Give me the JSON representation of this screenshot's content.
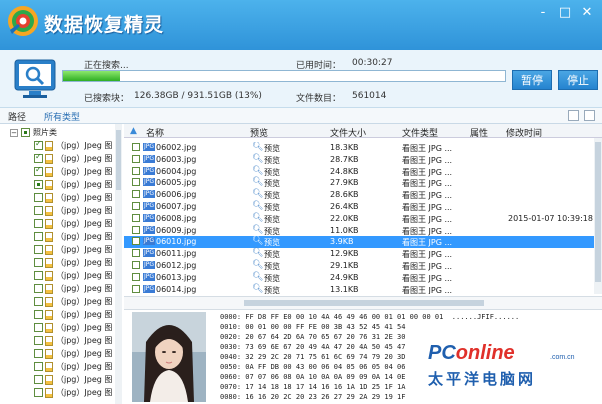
{
  "app": {
    "title": "数据恢复精灵"
  },
  "window": {
    "minimize": "-",
    "restore": "□",
    "close": "✕"
  },
  "scan": {
    "status_label": "正在搜索...",
    "elapsed_label": "已用时间：",
    "elapsed_value": "00:30:27",
    "searched_label": "已搜索块：",
    "searched_value": "126.38GB / 931.51GB (13%)",
    "progress_percent": 13,
    "count_label": "文件数目：",
    "count_value": "561014",
    "pause_button": "暂停",
    "stop_button": "停止"
  },
  "tabs": {
    "path": "路径",
    "all_types": "所有类型"
  },
  "tree": {
    "root": "照片类",
    "items": [
      "（jpg）Jpeg 图",
      "（jpg）Jpeg 图",
      "（jpg）Jpeg 图",
      "（jpg）Jpeg 图",
      "（jpg）Jpeg 图",
      "（jpg）Jpeg 图",
      "（jpg）Jpeg 图",
      "（jpg）Jpeg 图",
      "（jpg）Jpeg 图",
      "（jpg）Jpeg 图",
      "（jpg）Jpeg 图",
      "（jpg）Jpeg 图",
      "（jpg）Jpeg 图",
      "（jpg）Jpeg 图",
      "（jpg）Jpeg 图",
      "（jpg）Jpeg 图",
      "（jpg）Jpeg 图",
      "（jpg）Jpeg 图",
      "（jpg）Jpeg 图",
      "（jpg）Jpeg 图"
    ]
  },
  "table": {
    "headers": {
      "name": "名称",
      "preview": "预览",
      "size": "文件大小",
      "type": "文件类型",
      "attr": "属性",
      "modified": "修改时间"
    },
    "rows": [
      {
        "name": "06002.jpg",
        "preview": "预览",
        "size": "18.3KB",
        "type": "看图王 JPG ...",
        "modified": ""
      },
      {
        "name": "06003.jpg",
        "preview": "预览",
        "size": "28.7KB",
        "type": "看图王 JPG ...",
        "modified": ""
      },
      {
        "name": "06004.jpg",
        "preview": "预览",
        "size": "24.8KB",
        "type": "看图王 JPG ...",
        "modified": ""
      },
      {
        "name": "06005.jpg",
        "preview": "预览",
        "size": "27.9KB",
        "type": "看图王 JPG ...",
        "modified": ""
      },
      {
        "name": "06006.jpg",
        "preview": "预览",
        "size": "28.6KB",
        "type": "看图王 JPG ...",
        "modified": ""
      },
      {
        "name": "06007.jpg",
        "preview": "预览",
        "size": "26.4KB",
        "type": "看图王 JPG ...",
        "modified": ""
      },
      {
        "name": "06008.jpg",
        "preview": "预览",
        "size": "22.0KB",
        "type": "看图王 JPG ...",
        "modified": "2015-01-07 10:39:18"
      },
      {
        "name": "06009.jpg",
        "preview": "预览",
        "size": "11.0KB",
        "type": "看图王 JPG ...",
        "modified": ""
      },
      {
        "name": "06010.jpg",
        "preview": "预览",
        "size": "3.9KB",
        "type": "看图王 JPG ...",
        "modified": ""
      },
      {
        "name": "06011.jpg",
        "preview": "预览",
        "size": "12.9KB",
        "type": "看图王 JPG ...",
        "modified": ""
      },
      {
        "name": "06012.jpg",
        "preview": "预览",
        "size": "29.1KB",
        "type": "看图王 JPG ...",
        "modified": ""
      },
      {
        "name": "06013.jpg",
        "preview": "预览",
        "size": "24.9KB",
        "type": "看图王 JPG ...",
        "modified": ""
      },
      {
        "name": "06014.jpg",
        "preview": "预览",
        "size": "13.1KB",
        "type": "看图王 JPG ...",
        "modified": ""
      }
    ],
    "selected_index": 8
  },
  "hex": {
    "lines": [
      "0000: FF D8 FF E0 00 10 4A 46 49 46 00 01 01 00 00 01  ......JFIF......",
      "0010: 00 01 00 00 FF FE 00 3B 43 52 45 41 54",
      "0020: 20 67 64 2D 6A 70 65 67 20 76 31 2E 30",
      "0030: 73 69 6E 67 20 49 4A 47 20 4A 50 45 47",
      "0040: 32 29 2C 20 71 75 61 6C 69 74 79 20 3D",
      "0050: 0A FF DB 00 43 00 06 04 05 06 05 04 06",
      "0060: 07 07 06 08 0A 10 0A 0A 09 09 0A 14 0E",
      "0070: 17 14 18 18 17 14 16 16 1A 1D 25 1F 1A",
      "0080: 16 16 20 2C 20 23 26 27 29 2A 29 19 1F"
    ]
  },
  "watermark": {
    "brand_p": "PC",
    "brand_on": "online",
    "domain": ".com.cn",
    "cn": "太平洋电脑网"
  },
  "colors": {
    "title_bar": "#2f93d9",
    "selected_row": "#3399ff",
    "progress_fill": "#2eae22"
  }
}
